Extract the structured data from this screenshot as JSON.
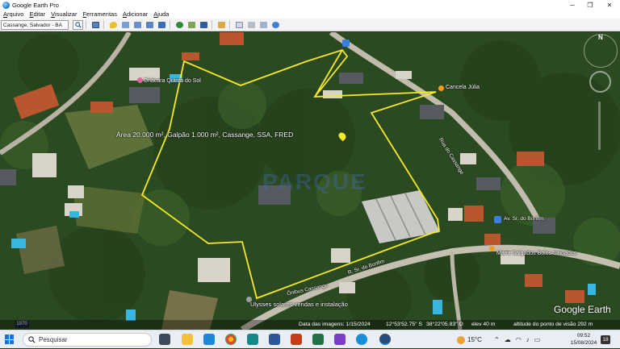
{
  "window": {
    "title": "Google Earth Pro",
    "controls": {
      "minimize": "─",
      "restore": "❐",
      "close": "✕"
    }
  },
  "menu": [
    "Arquivo",
    "Editar",
    "Visualizar",
    "Ferramentas",
    "Adicionar",
    "Ajuda"
  ],
  "toolbar": {
    "search_value": "Cassange, Salvador - BA",
    "buttons": [
      "sidebar-toggle",
      "placemark",
      "polygon",
      "path",
      "image-overlay",
      "record-tour",
      "historical-imagery",
      "sunlight",
      "planets",
      "ruler",
      "email",
      "print",
      "save-image",
      "google-maps"
    ]
  },
  "map": {
    "overlay_label": "Área 20.000 m², Galpão 1.000 m², Cassange, SSA, FRED",
    "watermark": "PARQUE",
    "places": [
      {
        "label": "Chácara Quinta do Sol"
      },
      {
        "label": "Cancela Júlia"
      },
      {
        "label": "Rua do Cassange"
      },
      {
        "label": "Av. Sr. do Bonfim"
      },
      {
        "label": "Maria Salgados Bolos Salgados"
      },
      {
        "label": "Ulysses solares vendas e instalação"
      },
      {
        "label": "Ônibus Cassange"
      },
      {
        "label": "R. Sr. do Bonfim"
      }
    ],
    "google_earth_logo": "Google Earth",
    "scale_badge": "1970"
  },
  "status": {
    "imagery_date": "Data das imagens: 1/15/2024",
    "lat": "12°53'52.75\" S",
    "lon": "38°22'05.83\" O",
    "elev": "elev  40 m",
    "eye_alt": "altitude do ponto de visão  292 m"
  },
  "taskbar": {
    "search_placeholder": "Pesquisar",
    "weather": "15°C",
    "time": "09:52",
    "date": "15/08/2024",
    "notifications": "18"
  },
  "colors": {
    "boundary": "#f5e92a",
    "poi_orange": "#f39c1f",
    "poi_blue": "#3b7de0",
    "accent": "#1a73d8"
  }
}
